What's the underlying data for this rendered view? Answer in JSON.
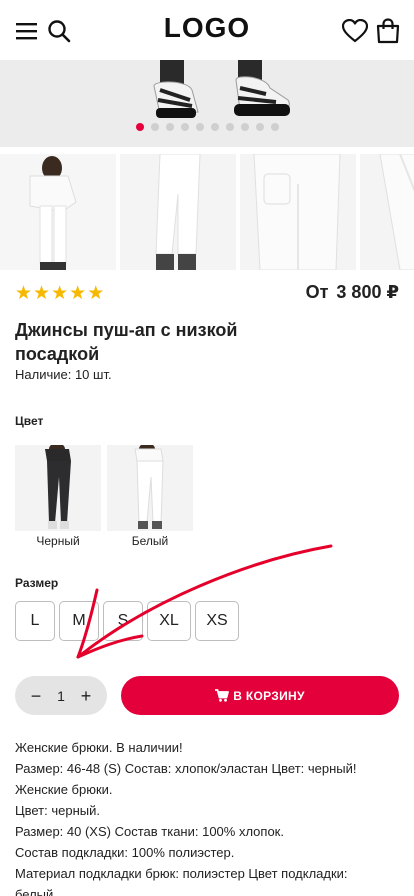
{
  "header": {
    "logo": "LOGO",
    "icons": [
      "menu-icon",
      "search-icon",
      "heart-icon",
      "bag-icon"
    ]
  },
  "carousel": {
    "slide_count": 10,
    "active_index": 0,
    "active_color": "#e6003c"
  },
  "product": {
    "rating_stars": 5,
    "price_prefix": "От",
    "price": "3 800 ₽",
    "title": "Джинсы пуш-ап с низкой посадкой",
    "stock": "Наличие: 10 шт."
  },
  "color": {
    "label": "Цвет",
    "options": [
      {
        "name": "Черный"
      },
      {
        "name": "Белый"
      }
    ]
  },
  "size": {
    "label": "Размер",
    "options": [
      "L",
      "M",
      "S",
      "XL",
      "XS"
    ]
  },
  "quantity": {
    "minus": "−",
    "value": "1",
    "plus": "+"
  },
  "cart": {
    "label": "В КОРЗИНУ",
    "color": "#e3003b"
  },
  "description": [
    "Женские брюки. В наличии!",
    "Размер: 46-48 (S) Состав: хлопок/эластан Цвет: черный!",
    "Женские брюки.",
    "Цвет: черный.",
    "Размер: 40 (XS) Состав ткани: 100% хлопок.",
    "Состав подкладки: 100% полиэстер.",
    "Материал подкладки брюк: полиэстер Цвет подкладки:",
    "белый"
  ]
}
